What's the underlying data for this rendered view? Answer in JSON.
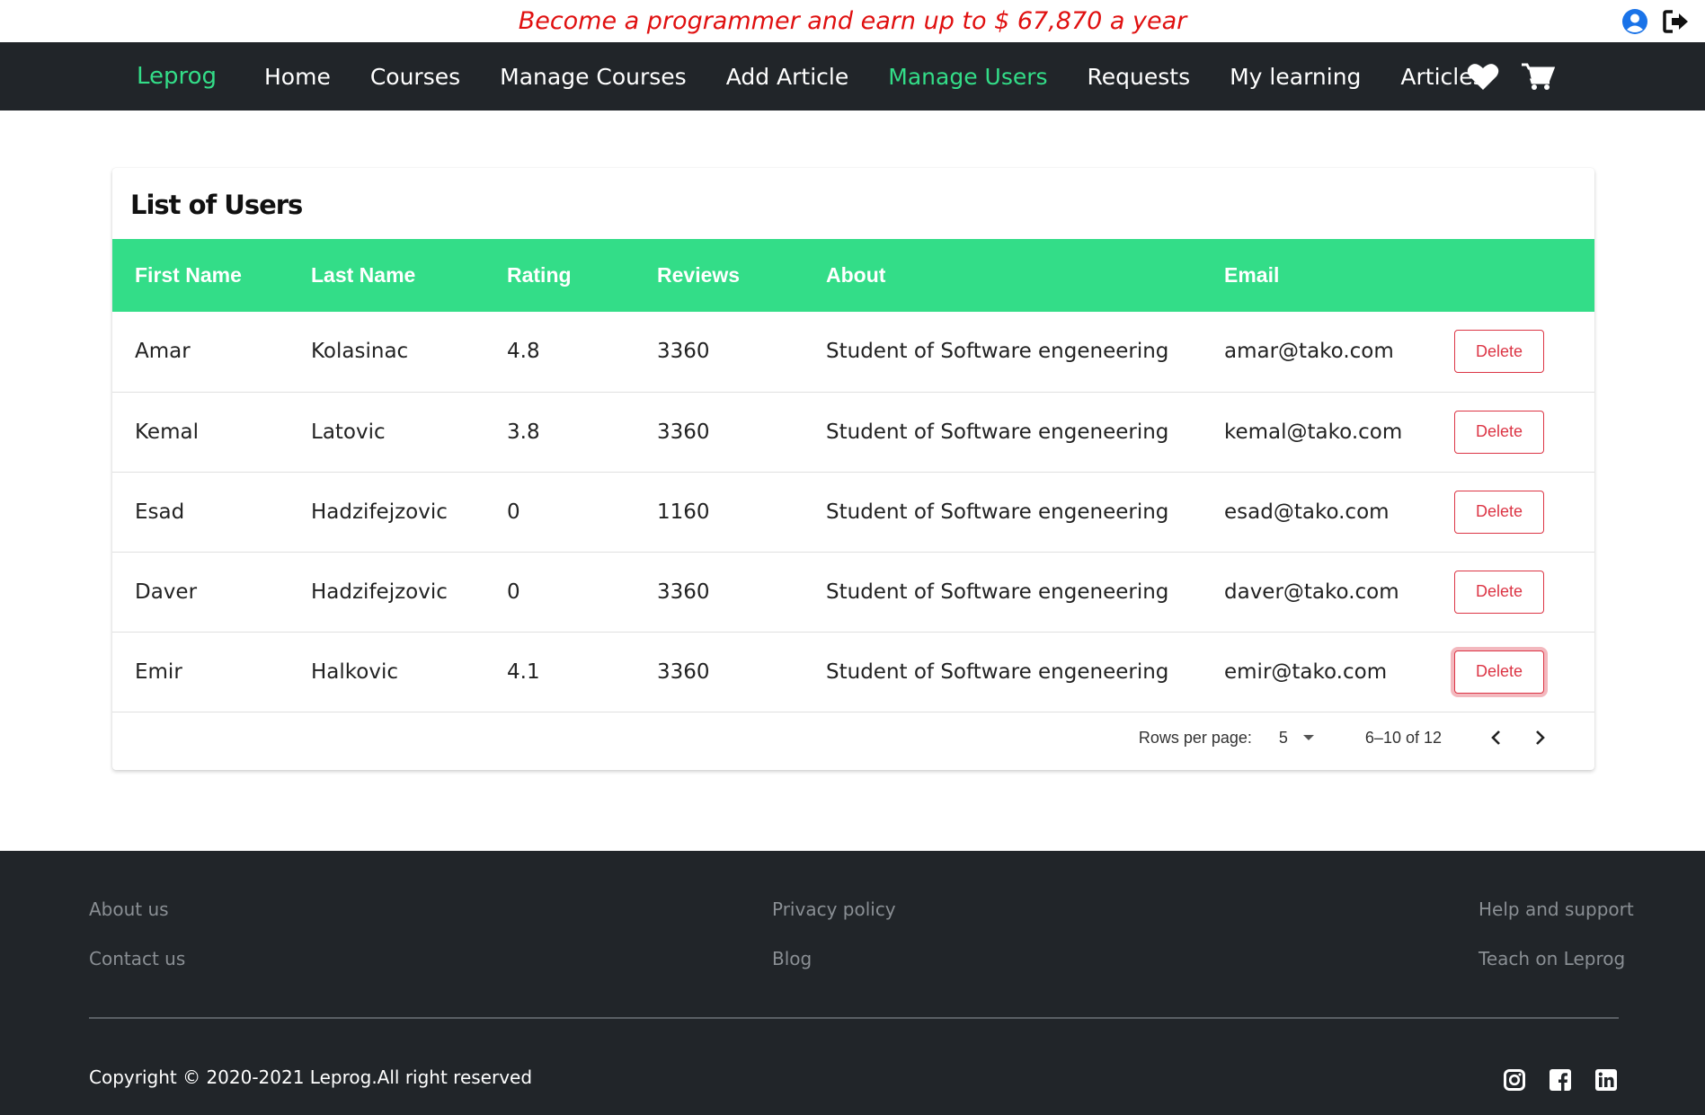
{
  "promo": {
    "text": "Become a programmer and earn up to $ 67,870 a year"
  },
  "top_icons": [
    "user-circle-icon",
    "sign-out-icon"
  ],
  "nav": {
    "brand": "Leprog",
    "links": [
      "Home",
      "Courses",
      "Manage Courses",
      "Add Article",
      "Manage Users",
      "Requests",
      "My learning",
      "Articles"
    ],
    "active_index": 4,
    "icons": [
      "heart-icon",
      "cart-icon"
    ]
  },
  "card": {
    "title": "List of Users",
    "columns": [
      "First Name",
      "Last Name",
      "Rating",
      "Reviews",
      "About",
      "Email"
    ],
    "rows": [
      {
        "first": "Amar",
        "last": "Kolasinac",
        "rating": "4.8",
        "reviews": "3360",
        "about": "Student of Software engeneering",
        "email": "amar@tako.com",
        "action": "Delete"
      },
      {
        "first": "Kemal",
        "last": "Latovic",
        "rating": "3.8",
        "reviews": "3360",
        "about": "Student of Software engeneering",
        "email": "kemal@tako.com",
        "action": "Delete"
      },
      {
        "first": "Esad",
        "last": "Hadzifejzovic",
        "rating": "0",
        "reviews": "1160",
        "about": "Student of Software engeneering",
        "email": "esad@tako.com",
        "action": "Delete"
      },
      {
        "first": "Daver",
        "last": "Hadzifejzovic",
        "rating": "0",
        "reviews": "3360",
        "about": "Student of Software engeneering",
        "email": "daver@tako.com",
        "action": "Delete"
      },
      {
        "first": "Emir",
        "last": "Halkovic",
        "rating": "4.1",
        "reviews": "3360",
        "about": "Student of Software engeneering",
        "email": "emir@tako.com",
        "action": "Delete"
      }
    ],
    "pagination": {
      "rows_per_page_label": "Rows per page:",
      "rows_per_page": "5",
      "range": "6–10 of 12"
    }
  },
  "footer": {
    "links": [
      "About us",
      "Contact us",
      "Privacy policy",
      "Blog",
      "Help and support",
      "Teach on Leprog"
    ],
    "copyright": "Copyright © 2020-2021 Leprog.All right reserved",
    "social_icons": [
      "instagram-icon",
      "facebook-icon",
      "linkedin-icon"
    ]
  },
  "colors": {
    "accent_green": "#33dd88",
    "nav_bg": "#212529",
    "promo_red": "#e01010",
    "danger": "#dc3545"
  }
}
